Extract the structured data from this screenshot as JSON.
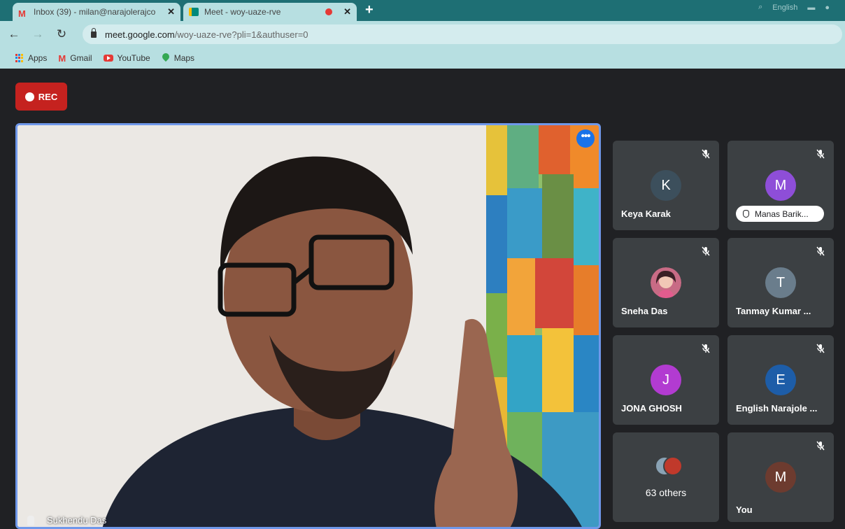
{
  "browser": {
    "tabs": [
      {
        "title": "Inbox (39) - milan@narajolerajco",
        "close": "✕"
      },
      {
        "title": "Meet - woy-uaze-rve",
        "close": "✕"
      }
    ],
    "new_tab": "+",
    "profile_label": "English",
    "url_host": "meet.google.com",
    "url_path": "/woy-uaze-rve?pli=1&authuser=0",
    "bookmarks": [
      "Apps",
      "Gmail",
      "YouTube",
      "Maps"
    ]
  },
  "meet": {
    "rec_label": "REC",
    "main_speaker": "Sukhendu Das",
    "colors": {
      "record_red": "#c5221f",
      "active_border": "#6f98ea",
      "tile_bg": "#3c4043",
      "page_bg": "#202124"
    },
    "participants": [
      {
        "name": "Keya Karak",
        "initial": "K",
        "avatar_color": "#3c4f5c",
        "muted": true
      },
      {
        "name": "Manas Barik...",
        "initial": "M",
        "avatar_color": "#8e4ed8",
        "muted": true,
        "hand_raised": true
      },
      {
        "name": "Sneha Das",
        "initial": "",
        "avatar_color": "#c86b85",
        "muted": true,
        "photo": true
      },
      {
        "name": "Tanmay Kumar ...",
        "initial": "T",
        "avatar_color": "#6a7d8c",
        "muted": true
      },
      {
        "name": "JONA GHOSH",
        "initial": "J",
        "avatar_color": "#b23bd1",
        "muted": true
      },
      {
        "name": "English Narajole ...",
        "initial": "E",
        "avatar_color": "#1d5da8",
        "muted": true
      },
      {
        "name": "63 others",
        "others": true
      },
      {
        "name": "You",
        "initial": "M",
        "avatar_color": "#6d3b2f",
        "muted": true
      }
    ]
  }
}
